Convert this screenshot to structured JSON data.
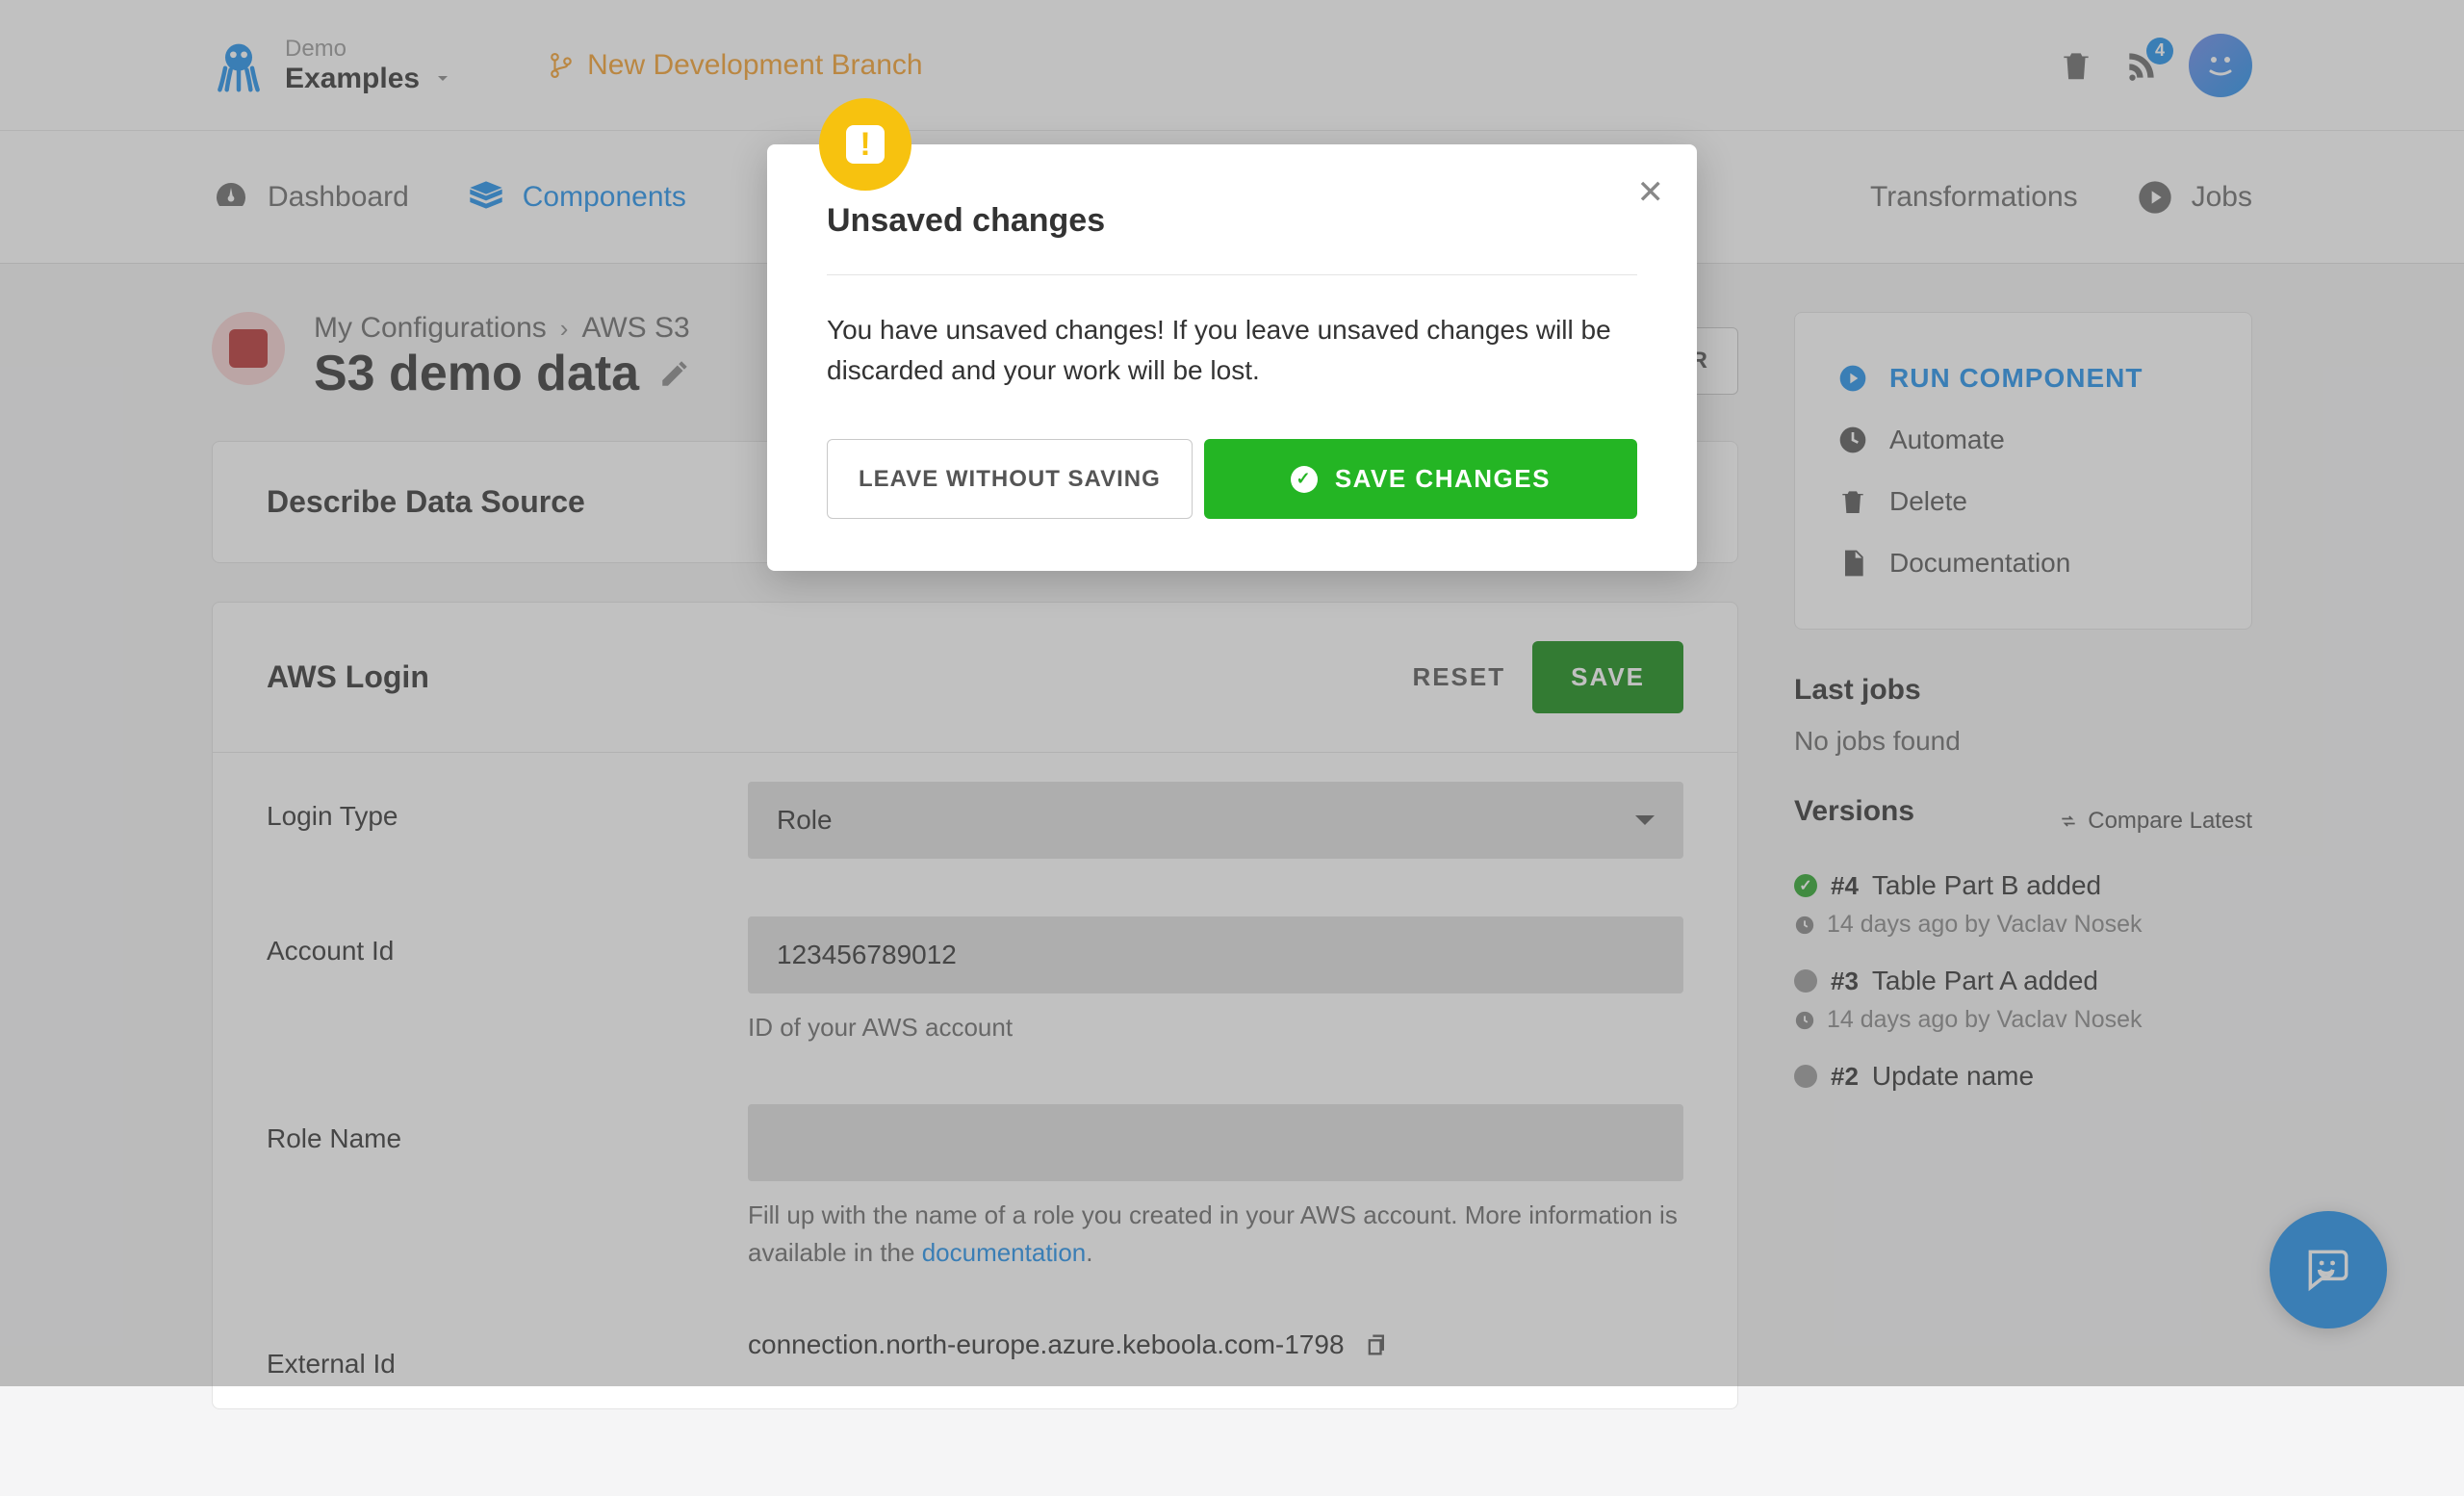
{
  "header": {
    "project_label": "Demo",
    "project_name": "Examples",
    "branch_name": "New Development Branch",
    "notification_count": "4"
  },
  "nav": {
    "dashboard": "Dashboard",
    "components": "Components",
    "transformations": "Transformations",
    "jobs": "Jobs"
  },
  "breadcrumb": {
    "item1": "My Configurations",
    "item2": "AWS S3",
    "title": "S3 demo data"
  },
  "json_editor_label": "JSON EDITOR",
  "describe_title": "Describe Data Source",
  "login": {
    "title": "AWS Login",
    "reset": "RESET",
    "save": "SAVE",
    "login_type_label": "Login Type",
    "login_type_value": "Role",
    "account_id_label": "Account Id",
    "account_id_value": "123456789012",
    "account_id_help": "ID of your AWS account",
    "role_name_label": "Role Name",
    "role_name_value": "",
    "role_name_help_1": "Fill up with the name of a role you created in your AWS account. More information is available in the ",
    "role_name_help_link": "documentation",
    "external_id_label": "External Id",
    "external_id_value": "connection.north-europe.azure.keboola.com-1798"
  },
  "side_actions": {
    "run": "RUN COMPONENT",
    "automate": "Automate",
    "delete": "Delete",
    "documentation": "Documentation"
  },
  "last_jobs": {
    "heading": "Last jobs",
    "empty": "No jobs found"
  },
  "versions": {
    "heading": "Versions",
    "compare": "Compare Latest",
    "items": [
      {
        "num": "#4",
        "name": "Table Part B added",
        "meta": "14 days ago by Vaclav Nosek",
        "status": "success"
      },
      {
        "num": "#3",
        "name": "Table Part A added",
        "meta": "14 days ago by Vaclav Nosek",
        "status": "neutral"
      },
      {
        "num": "#2",
        "name": "Update name",
        "meta": "",
        "status": "neutral"
      }
    ]
  },
  "modal": {
    "title": "Unsaved changes",
    "body": "You have unsaved changes! If you leave unsaved changes will be discarded and your work will be lost.",
    "leave": "LEAVE WITHOUT SAVING",
    "save": "SAVE CHANGES"
  }
}
